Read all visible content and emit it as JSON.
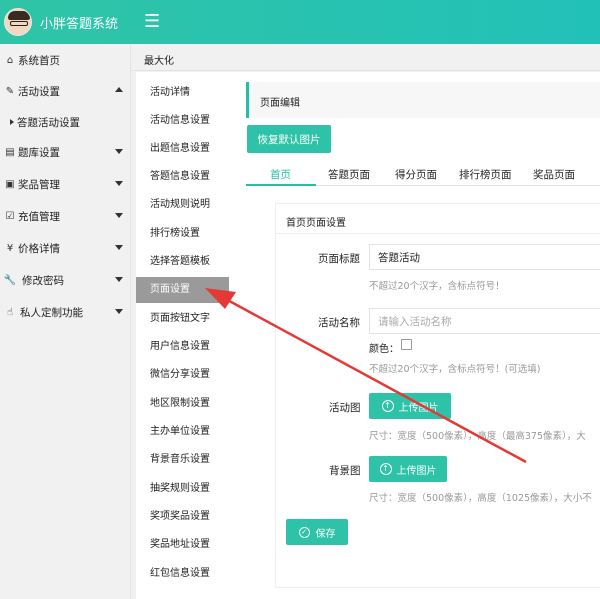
{
  "header": {
    "app_title": "小胖答题系统",
    "menu_icon": "hamburger-icon"
  },
  "sidebar": {
    "items": [
      {
        "label": "系统首页",
        "icon": "home-icon"
      },
      {
        "label": "活动设置",
        "icon": "edit-icon",
        "expanded": true
      },
      {
        "label": "答题活动设置",
        "sub": true
      },
      {
        "label": "题库设置",
        "icon": "book-icon"
      },
      {
        "label": "奖品管理",
        "icon": "gift-icon"
      },
      {
        "label": "充值管理",
        "icon": "checkbox-icon"
      },
      {
        "label": "价格详情",
        "icon": "yen-icon"
      },
      {
        "label": "修改密码",
        "icon": "wrench-icon"
      },
      {
        "label": "私人定制功能",
        "icon": "hand-icon"
      }
    ]
  },
  "maxbar": {
    "label": "最大化"
  },
  "submenu": {
    "items": [
      "活动详情",
      "活动信息设置",
      "出题信息设置",
      "答题信息设置",
      "活动规则说明",
      "排行榜设置",
      "选择答题模板",
      "页面设置",
      "页面按钮文字",
      "用户信息设置",
      "微信分享设置",
      "地区限制设置",
      "主办单位设置",
      "背景音乐设置",
      "抽奖规则设置",
      "奖项奖品设置",
      "奖品地址设置",
      "红包信息设置"
    ],
    "active_index": 7
  },
  "main": {
    "panel_title": "页面编辑",
    "restore_button": "恢复默认图片",
    "tabs": [
      "首页",
      "答题页面",
      "得分页面",
      "排行榜页面",
      "奖品页面"
    ],
    "active_tab": 0,
    "card": {
      "title": "首页页面设置",
      "page_title_label": "页面标题",
      "page_title_value": "答题活动",
      "page_title_hint": "不超过20个汉字，含标点符号！",
      "activity_name_label": "活动名称",
      "activity_name_placeholder": "请输入活动名称",
      "color_label": "颜色：",
      "activity_name_hint": "不超过20个汉字，含标点符号！(可选填)",
      "activity_image_label": "活动图",
      "upload_button": "上传图片",
      "activity_image_hint": "尺寸：宽度（500像素），高度（最高375像素），大",
      "background_label": "背景图",
      "background_hint": "尺寸：宽度（500像素），高度（1025像素），大小不",
      "save_button": "保存"
    }
  },
  "colors": {
    "accent": "#2ec3a8",
    "annotation_arrow": "#e53935",
    "active_menu": "#9a9a9a"
  }
}
